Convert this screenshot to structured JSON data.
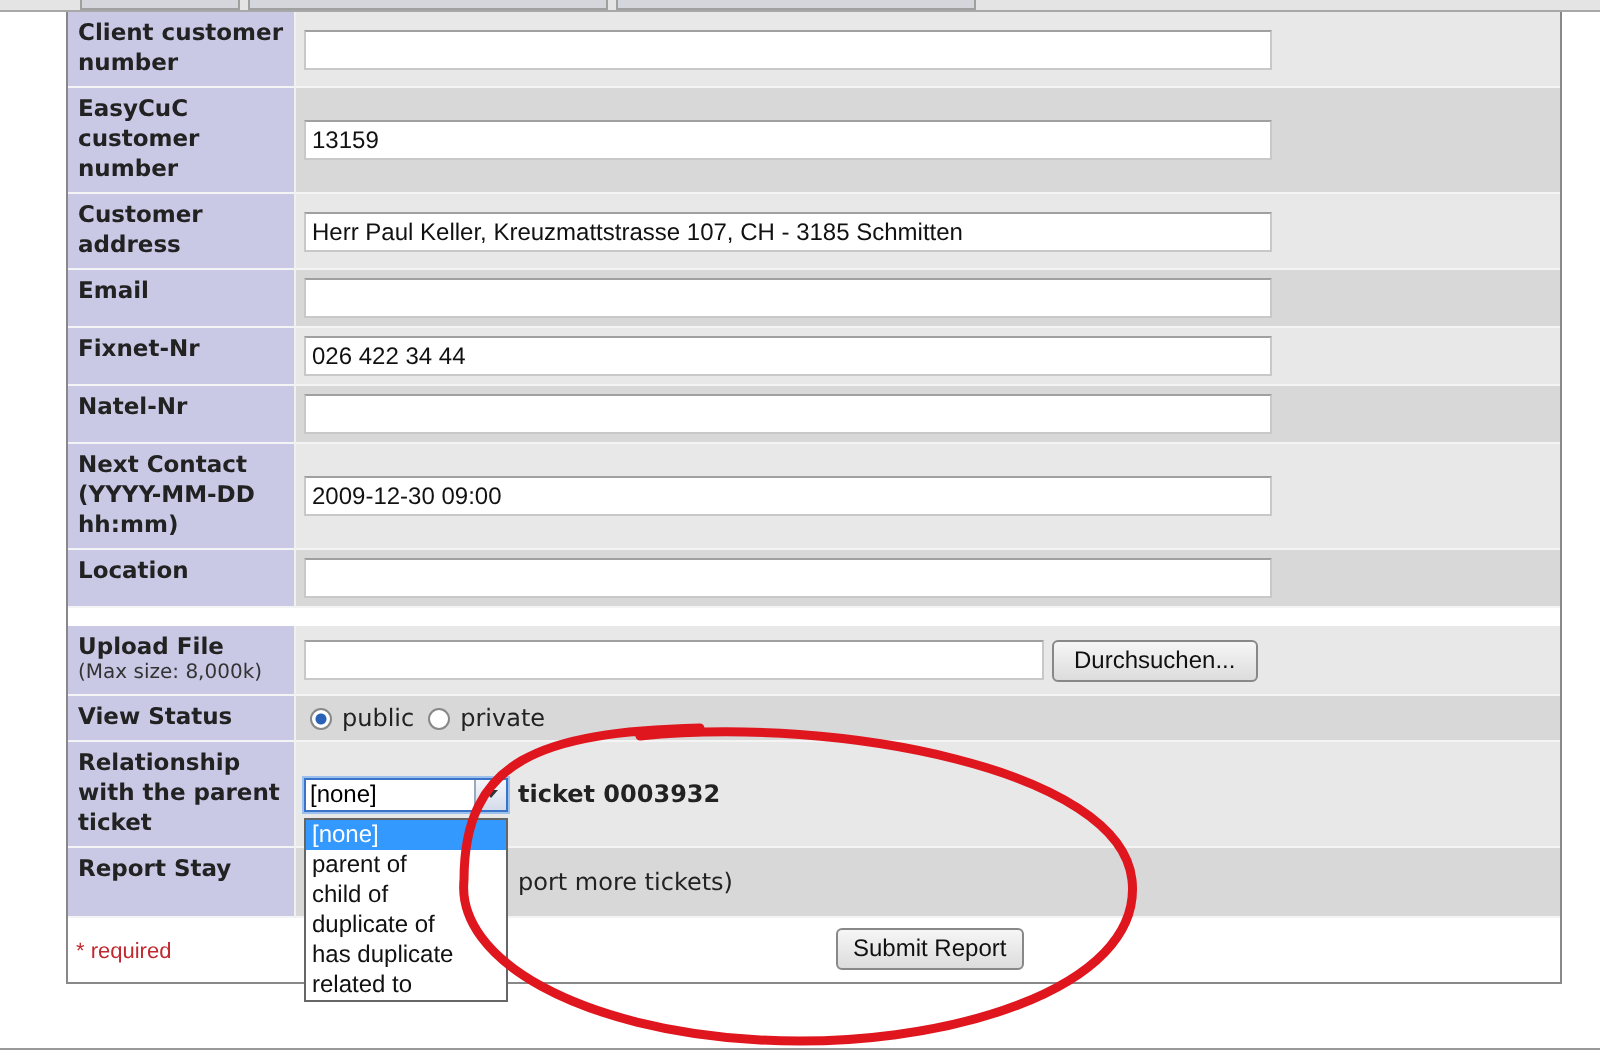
{
  "form": {
    "rows": [
      {
        "kind": "text",
        "label": "Client customer number"
      },
      {
        "kind": "text",
        "label": "EasyCuC customer number",
        "value": "13159"
      },
      {
        "kind": "text",
        "label": "Customer address",
        "value": "Herr Paul Keller, Kreuzmattstrasse 107, CH - 3185 Schmitten"
      },
      {
        "kind": "text",
        "label": "Email"
      },
      {
        "kind": "text",
        "label": "Fixnet-Nr",
        "value": "026 422 34 44"
      },
      {
        "kind": "text",
        "label": "Natel-Nr"
      },
      {
        "kind": "text",
        "label": "Next Contact (YYYY-MM-DD hh:mm)",
        "value": "2009-12-30 09:00"
      },
      {
        "kind": "text",
        "label": "Location"
      },
      {
        "kind": "spacer"
      },
      {
        "kind": "file",
        "label": "Upload File",
        "hint": "(Max size: 8,000k)",
        "button": "Durchsuchen..."
      },
      {
        "kind": "radio",
        "label": "View Status",
        "options": [
          {
            "label": "public",
            "selected": true
          },
          {
            "label": "private",
            "selected": false
          }
        ]
      },
      {
        "kind": "relationship",
        "label": "Relationship with the parent ticket",
        "ticket": "ticket 0003932",
        "select": {
          "value": "[none]",
          "expanded": true,
          "options": [
            {
              "label": "[none]",
              "selected": true
            },
            {
              "label": "parent of",
              "selected": false
            },
            {
              "label": "child of",
              "selected": false
            },
            {
              "label": "duplicate of",
              "selected": false
            },
            {
              "label": "has duplicate",
              "selected": false
            },
            {
              "label": "related to",
              "selected": false
            }
          ]
        }
      },
      {
        "kind": "note",
        "label": "Report Stay",
        "text": "port more tickets)"
      }
    ],
    "required_note": "* required",
    "submit": "Submit Report"
  },
  "annotation": {
    "kind": "ellipse"
  }
}
